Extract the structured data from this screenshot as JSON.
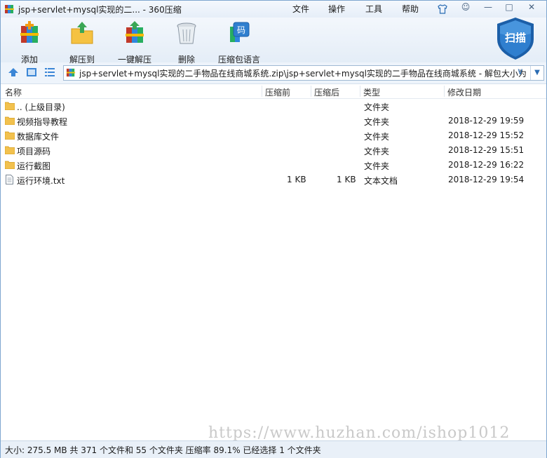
{
  "window": {
    "title": "jsp+servlet+mysql实现的二... - 360压缩",
    "menu": [
      "文件",
      "操作",
      "工具",
      "帮助"
    ]
  },
  "toolbar": {
    "buttons": [
      {
        "label": "添加",
        "icon": "add-archive-icon"
      },
      {
        "label": "解压到",
        "icon": "extract-to-icon"
      },
      {
        "label": "一键解压",
        "icon": "one-click-extract-icon"
      },
      {
        "label": "删除",
        "icon": "trash-bin-icon"
      },
      {
        "label": "压缩包语言",
        "icon": "archive-language-icon"
      }
    ],
    "scan_label": "扫描",
    "colors": {
      "scan_shield": "#2f7fcf",
      "scan_shield_dark": "#1c5fa8"
    }
  },
  "address": {
    "path": "jsp+servlet+mysql实现的二手物品在线商城系统.zip\\jsp+servlet+mysql实现的二手物品在线商城系统 - 解包大小为"
  },
  "columns": {
    "name": "名称",
    "packed": "压缩前",
    "unpacked": "压缩后",
    "type": "类型",
    "modified": "修改日期"
  },
  "files": [
    {
      "name": ".. (上级目录)",
      "packed": "",
      "unpacked": "",
      "type": "文件夹",
      "modified": "",
      "icon": "folder-icon"
    },
    {
      "name": "视频指导教程",
      "packed": "",
      "unpacked": "",
      "type": "文件夹",
      "modified": "2018-12-29 19:59",
      "icon": "folder-icon"
    },
    {
      "name": "数据库文件",
      "packed": "",
      "unpacked": "",
      "type": "文件夹",
      "modified": "2018-12-29 15:52",
      "icon": "folder-icon"
    },
    {
      "name": "项目源码",
      "packed": "",
      "unpacked": "",
      "type": "文件夹",
      "modified": "2018-12-29 15:51",
      "icon": "folder-icon"
    },
    {
      "name": "运行截图",
      "packed": "",
      "unpacked": "",
      "type": "文件夹",
      "modified": "2018-12-29 16:22",
      "icon": "folder-icon"
    },
    {
      "name": "运行环境.txt",
      "packed": "1 KB",
      "unpacked": "1 KB",
      "type": "文本文档",
      "modified": "2018-12-29 19:54",
      "icon": "text-file-icon"
    }
  ],
  "watermark": "https://www.huzhan.com/ishop1012",
  "status": "大小: 275.5 MB 共 371 个文件和 55 个文件夹 压缩率 89.1% 已经选择 1 个文件夹"
}
